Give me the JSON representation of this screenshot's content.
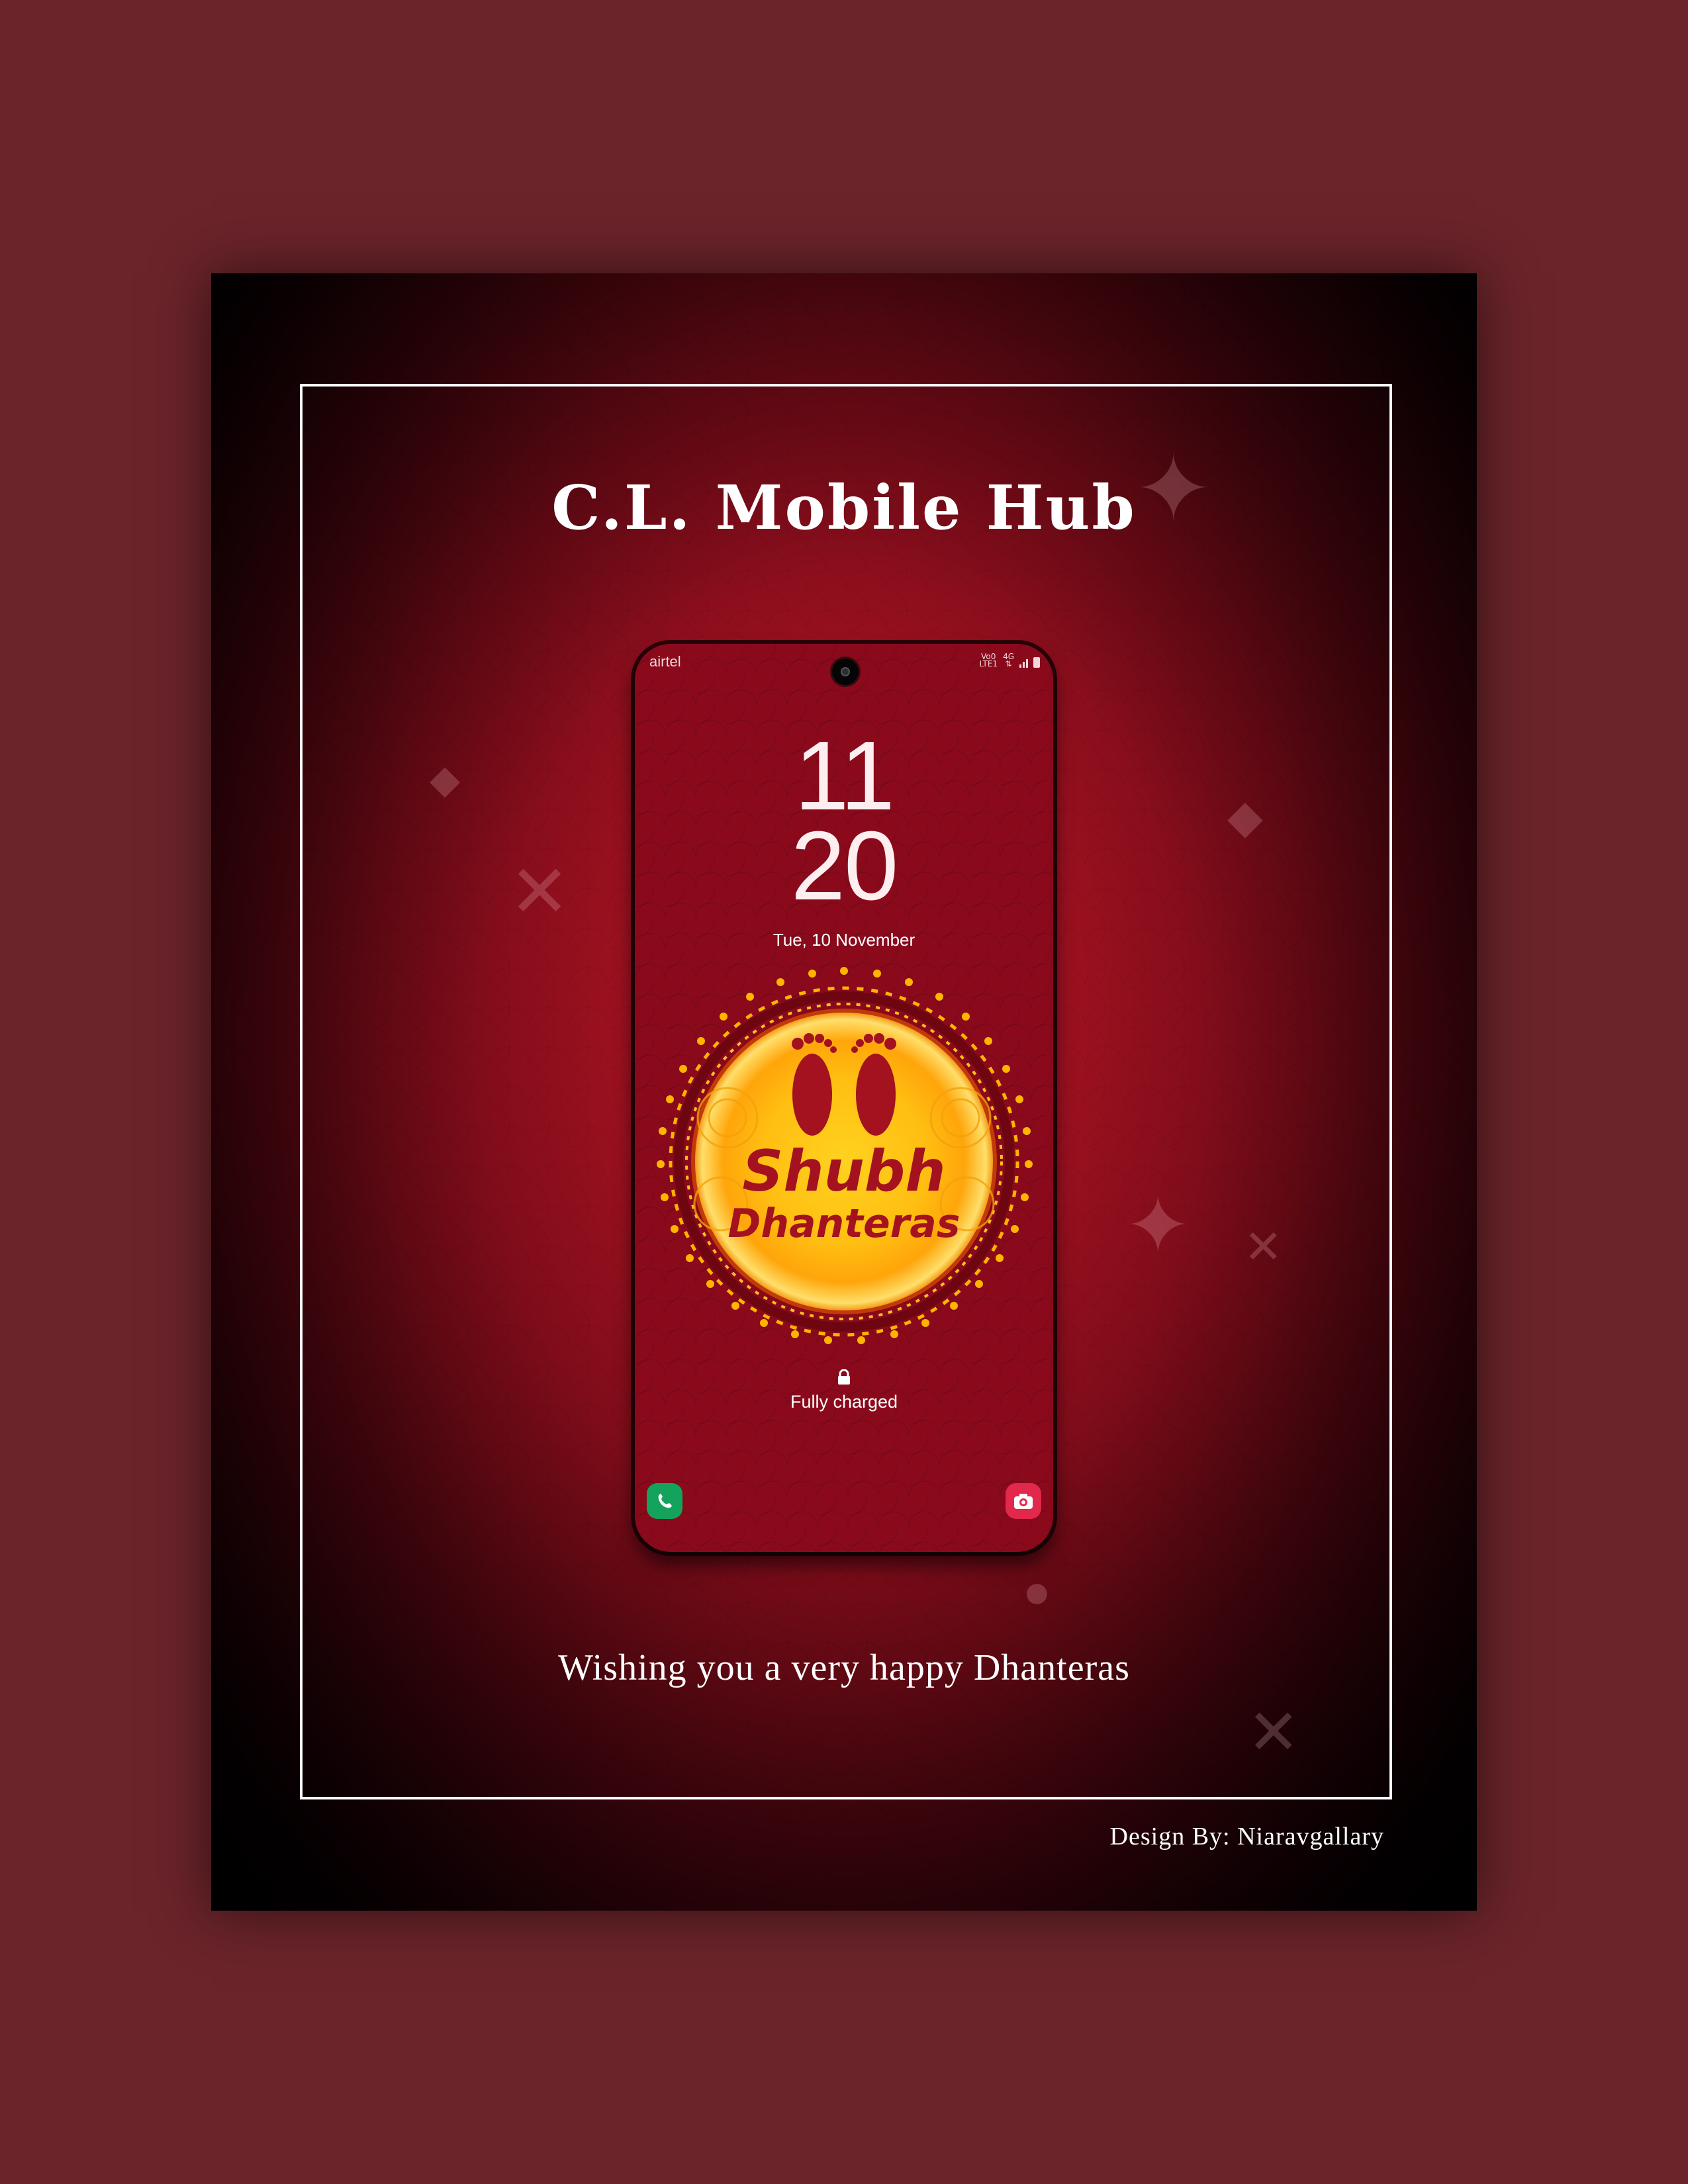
{
  "poster": {
    "title": "C.L. Mobile Hub",
    "wish": "Wishing you a very happy Dhanteras",
    "credit": "Design By: Niaravgallary"
  },
  "lockscreen": {
    "carrier": "airtel",
    "status_indicators": [
      "VoLTE1",
      "4G",
      "signal-icon",
      "battery-icon"
    ],
    "status_vo": "Vo0",
    "status_lte": "LTE1",
    "status_4g": "4G",
    "clock_hours": "11",
    "clock_minutes": "20",
    "date": "Tue, 10 November",
    "emblem_line1": "Shubh",
    "emblem_line2": "Dhanteras",
    "charge_status": "Fully charged",
    "shortcuts": [
      "phone-icon",
      "camera-icon"
    ]
  },
  "colors": {
    "page_background": "#6a242a",
    "poster_red": "#98101f",
    "emblem_yellow": "#ffc21a",
    "emblem_text": "#a3121e",
    "phone_shortcut": "#13a35c",
    "camera_shortcut": "#e2284b"
  }
}
